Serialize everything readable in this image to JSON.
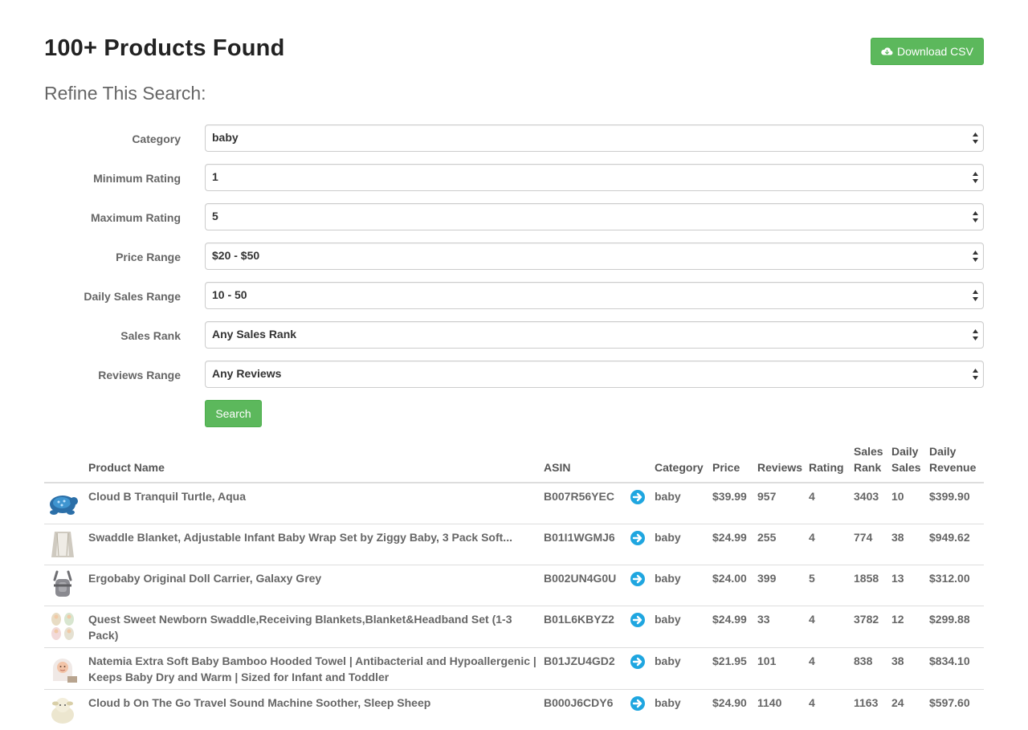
{
  "header": {
    "title": "100+ Products Found",
    "download_label": "Download CSV",
    "download_icon": "cloud-download-icon"
  },
  "refine": {
    "title": "Refine This Search:",
    "fields": [
      {
        "label": "Category",
        "value": "baby"
      },
      {
        "label": "Minimum Rating",
        "value": "1"
      },
      {
        "label": "Maximum Rating",
        "value": "5"
      },
      {
        "label": "Price Range",
        "value": "$20 - $50"
      },
      {
        "label": "Daily Sales Range",
        "value": "10 - 50"
      },
      {
        "label": "Sales Rank",
        "value": "Any Sales Rank"
      },
      {
        "label": "Reviews Range",
        "value": "Any Reviews"
      }
    ],
    "search_label": "Search"
  },
  "table": {
    "columns": {
      "product_name": "Product Name",
      "asin": "ASIN",
      "category": "Category",
      "price": "Price",
      "reviews": "Reviews",
      "rating": "Rating",
      "sales_rank_1": "Sales",
      "sales_rank_2": "Rank",
      "daily_sales_1": "Daily",
      "daily_sales_2": "Sales",
      "daily_revenue_1": "Daily",
      "daily_revenue_2": "Revenue"
    },
    "rows": [
      {
        "name": "Cloud B Tranquil Turtle, Aqua",
        "asin": "B007R56YEC",
        "category": "baby",
        "price": "$39.99",
        "reviews": "957",
        "rating": "4",
        "sales_rank": "3403",
        "daily_sales": "10",
        "daily_revenue": "$399.90",
        "thumb": "turtle-toy"
      },
      {
        "name": "Swaddle Blanket, Adjustable Infant Baby Wrap Set by Ziggy Baby, 3 Pack Soft...",
        "asin": "B01I1WGMJ6",
        "category": "baby",
        "price": "$24.99",
        "reviews": "255",
        "rating": "4",
        "sales_rank": "774",
        "daily_sales": "38",
        "daily_revenue": "$949.62",
        "thumb": "swaddle-blanket"
      },
      {
        "name": "Ergobaby Original Doll Carrier, Galaxy Grey",
        "asin": "B002UN4G0U",
        "category": "baby",
        "price": "$24.00",
        "reviews": "399",
        "rating": "5",
        "sales_rank": "1858",
        "daily_sales": "13",
        "daily_revenue": "$312.00",
        "thumb": "doll-carrier"
      },
      {
        "name": "Quest Sweet Newborn Swaddle,Receiving Blankets,Blanket&Headband Set (1-3 Pack)",
        "asin": "B01L6KBYZ2",
        "category": "baby",
        "price": "$24.99",
        "reviews": "33",
        "rating": "4",
        "sales_rank": "3782",
        "daily_sales": "12",
        "daily_revenue": "$299.88",
        "thumb": "swaddle-set"
      },
      {
        "name": "Natemia Extra Soft Baby Bamboo Hooded Towel | Antibacterial and Hypoallergenic | Keeps Baby Dry and Warm | Sized for Infant and Toddler",
        "asin": "B01JZU4GD2",
        "category": "baby",
        "price": "$21.95",
        "reviews": "101",
        "rating": "4",
        "sales_rank": "838",
        "daily_sales": "38",
        "daily_revenue": "$834.10",
        "thumb": "hooded-towel"
      },
      {
        "name": "Cloud b On The Go Travel Sound Machine Soother, Sleep Sheep",
        "asin": "B000J6CDY6",
        "category": "baby",
        "price": "$24.90",
        "reviews": "1140",
        "rating": "4",
        "sales_rank": "1163",
        "daily_sales": "24",
        "daily_revenue": "$597.60",
        "thumb": "sleep-sheep"
      }
    ]
  },
  "colors": {
    "success": "#5cb85c",
    "link_icon": "#1fa6e0",
    "border": "#dddddd"
  }
}
